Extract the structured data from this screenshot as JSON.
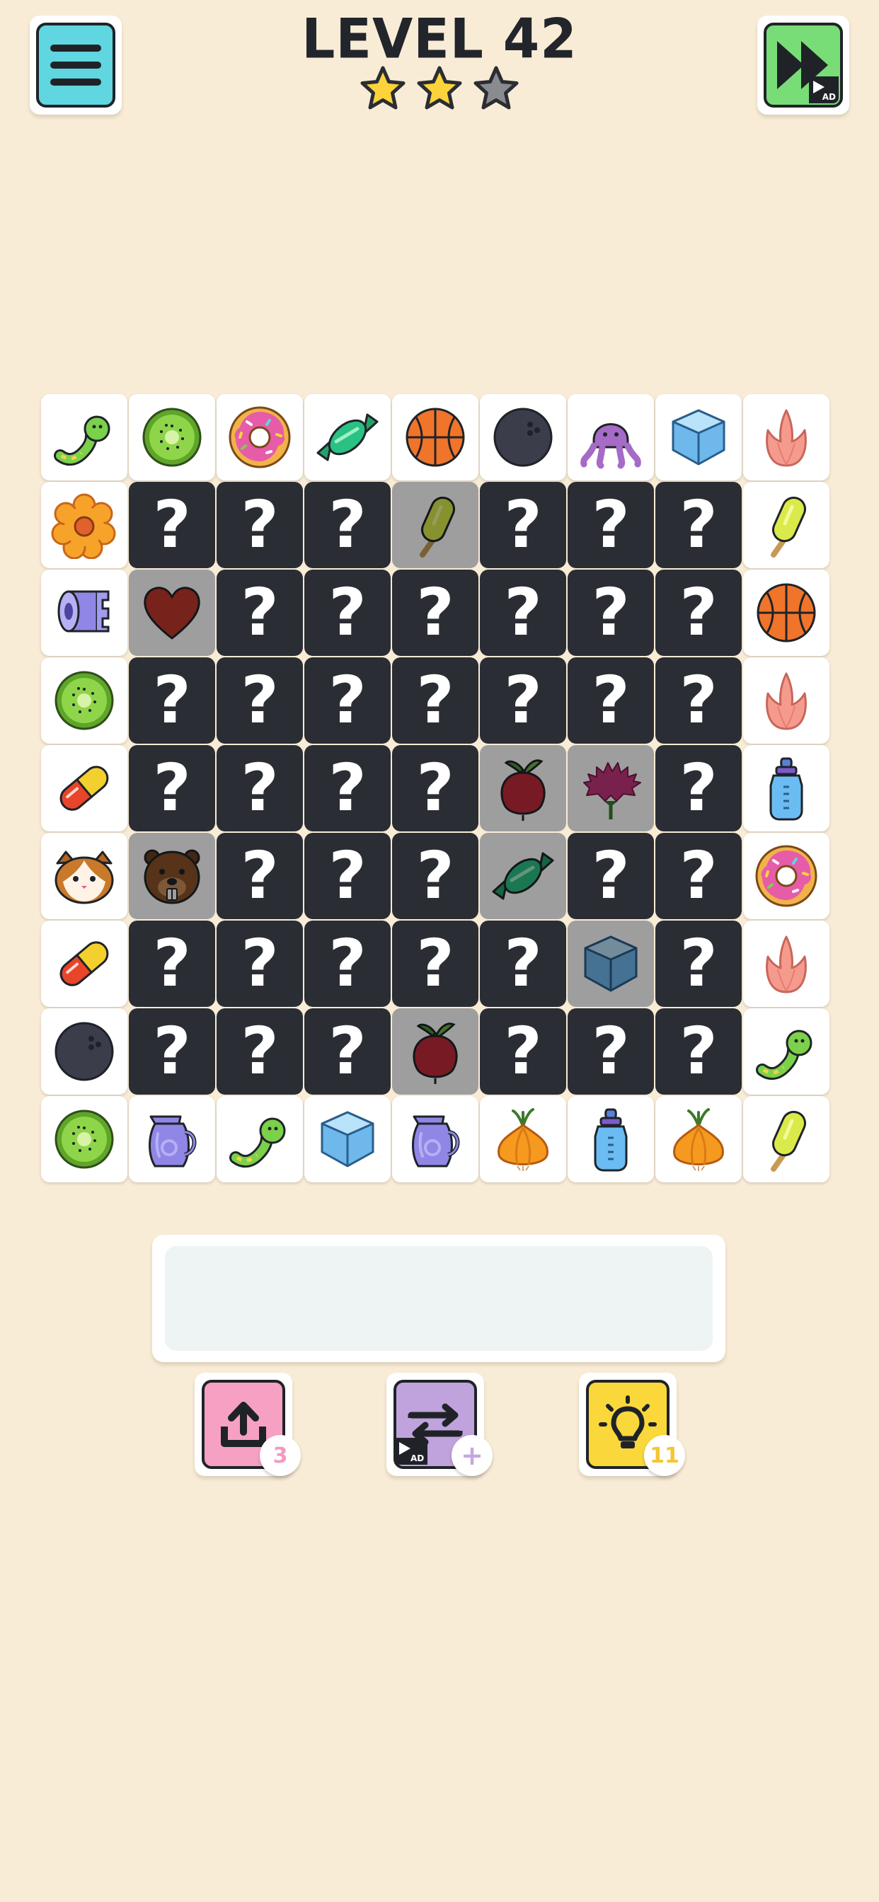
{
  "header": {
    "level_title": "LEVEL 42",
    "stars_earned": 2,
    "stars_total": 3,
    "menu_icon": "hamburger-menu-icon",
    "skip_icon": "fast-forward-icon",
    "skip_badge": "AD"
  },
  "board": {
    "rows": [
      [
        {
          "s": "face",
          "i": "worm"
        },
        {
          "s": "face",
          "i": "kiwi"
        },
        {
          "s": "face",
          "i": "donut"
        },
        {
          "s": "face",
          "i": "candy"
        },
        {
          "s": "face",
          "i": "basketball"
        },
        {
          "s": "face",
          "i": "bowling-ball"
        },
        {
          "s": "face",
          "i": "octopus"
        },
        {
          "s": "face",
          "i": "ice-cube"
        },
        {
          "s": "face",
          "i": "tulip"
        }
      ],
      [
        {
          "s": "face",
          "i": "flower"
        },
        {
          "s": "hidden"
        },
        {
          "s": "hidden"
        },
        {
          "s": "hidden"
        },
        {
          "s": "dim",
          "i": "popsicle"
        },
        {
          "s": "hidden"
        },
        {
          "s": "hidden"
        },
        {
          "s": "hidden"
        },
        {
          "s": "face",
          "i": "popsicle"
        }
      ],
      [
        {
          "s": "face",
          "i": "toilet-paper"
        },
        {
          "s": "dim",
          "i": "heart"
        },
        {
          "s": "hidden"
        },
        {
          "s": "hidden"
        },
        {
          "s": "hidden"
        },
        {
          "s": "hidden"
        },
        {
          "s": "hidden"
        },
        {
          "s": "hidden"
        },
        {
          "s": "face",
          "i": "basketball"
        }
      ],
      [
        {
          "s": "face",
          "i": "kiwi"
        },
        {
          "s": "hidden"
        },
        {
          "s": "hidden"
        },
        {
          "s": "hidden"
        },
        {
          "s": "hidden"
        },
        {
          "s": "hidden"
        },
        {
          "s": "hidden"
        },
        {
          "s": "hidden"
        },
        {
          "s": "face",
          "i": "tulip"
        }
      ],
      [
        {
          "s": "face",
          "i": "pill"
        },
        {
          "s": "hidden"
        },
        {
          "s": "hidden"
        },
        {
          "s": "hidden"
        },
        {
          "s": "hidden"
        },
        {
          "s": "dim",
          "i": "beet"
        },
        {
          "s": "dim",
          "i": "carnation"
        },
        {
          "s": "hidden"
        },
        {
          "s": "face",
          "i": "baby-bottle"
        }
      ],
      [
        {
          "s": "face",
          "i": "hamster"
        },
        {
          "s": "dim",
          "i": "beaver"
        },
        {
          "s": "hidden"
        },
        {
          "s": "hidden"
        },
        {
          "s": "hidden"
        },
        {
          "s": "dim",
          "i": "candy"
        },
        {
          "s": "hidden"
        },
        {
          "s": "hidden"
        },
        {
          "s": "face",
          "i": "donut"
        }
      ],
      [
        {
          "s": "face",
          "i": "pill"
        },
        {
          "s": "hidden"
        },
        {
          "s": "hidden"
        },
        {
          "s": "hidden"
        },
        {
          "s": "hidden"
        },
        {
          "s": "hidden"
        },
        {
          "s": "dim",
          "i": "ice-cube"
        },
        {
          "s": "hidden"
        },
        {
          "s": "face",
          "i": "tulip"
        }
      ],
      [
        {
          "s": "face",
          "i": "bowling-ball"
        },
        {
          "s": "hidden"
        },
        {
          "s": "hidden"
        },
        {
          "s": "hidden"
        },
        {
          "s": "dim",
          "i": "beet"
        },
        {
          "s": "hidden"
        },
        {
          "s": "hidden"
        },
        {
          "s": "hidden"
        },
        {
          "s": "face",
          "i": "worm"
        }
      ],
      [
        {
          "s": "face",
          "i": "kiwi"
        },
        {
          "s": "face",
          "i": "pitcher"
        },
        {
          "s": "face",
          "i": "worm"
        },
        {
          "s": "face",
          "i": "ice-cube"
        },
        {
          "s": "face",
          "i": "pitcher"
        },
        {
          "s": "face",
          "i": "onion"
        },
        {
          "s": "face",
          "i": "baby-bottle"
        },
        {
          "s": "face",
          "i": "onion"
        },
        {
          "s": "face",
          "i": "popsicle"
        }
      ]
    ],
    "hidden_symbol": "?"
  },
  "tray": {
    "slots_filled": 0
  },
  "tools": {
    "undo": {
      "icon": "undo-share-icon",
      "count": "3",
      "color": "#f6a0c4",
      "count_color": "#f29ac0"
    },
    "shuffle": {
      "icon": "shuffle-icon",
      "count": "+",
      "color": "#c0a2dc",
      "count_color": "#c5a8df",
      "badge": "AD"
    },
    "hint": {
      "icon": "lightbulb-icon",
      "count": "11",
      "color": "#fad73b",
      "count_color": "#f5c533"
    }
  },
  "colors": {
    "background": "#f9ecd6",
    "hidden_tile": "#2a2d33",
    "dim_tile": "#9e9e9e",
    "menu_button": "#5fd6e0",
    "skip_button": "#78dd77"
  }
}
